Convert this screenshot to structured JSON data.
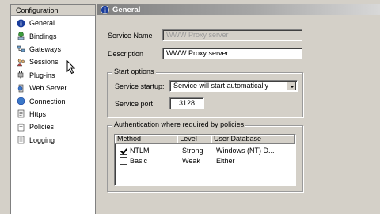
{
  "sidebar": {
    "header": "Configuration",
    "items": [
      {
        "label": "General",
        "icon": "info-icon"
      },
      {
        "label": "Bindings",
        "icon": "network-icon"
      },
      {
        "label": "Gateways",
        "icon": "gateway-icon"
      },
      {
        "label": "Sessions",
        "icon": "sessions-icon"
      },
      {
        "label": "Plug-ins",
        "icon": "plugin-icon"
      },
      {
        "label": "Web Server",
        "icon": "web-server-icon"
      },
      {
        "label": "Connection",
        "icon": "connection-icon"
      },
      {
        "label": "Https",
        "icon": "https-icon"
      },
      {
        "label": "Policies",
        "icon": "policies-icon"
      },
      {
        "label": "Logging",
        "icon": "logging-icon"
      }
    ]
  },
  "general": {
    "title": "General",
    "service_name_label": "Service Name",
    "service_name_value": "WWW Proxy server",
    "description_label": "Description",
    "description_value": "WWW Proxy server",
    "start_options": {
      "title": "Start options",
      "startup_label": "Service startup:",
      "startup_value": "Service will start automatically",
      "port_label": "Service port",
      "port_value": "3128"
    },
    "auth": {
      "title": "Authentication where required by policies",
      "columns": [
        "Method",
        "Level",
        "User Database"
      ],
      "rows": [
        {
          "checked": true,
          "method": "NTLM",
          "level": "Strong",
          "db": "Windows (NT) D..."
        },
        {
          "checked": false,
          "method": "Basic",
          "level": "Weak",
          "db": "Either"
        }
      ]
    }
  },
  "colors": {
    "window_bg": "#d4d0c8",
    "header_gradient_start": "#808080",
    "info_icon_blue": "#1a3d9c"
  }
}
